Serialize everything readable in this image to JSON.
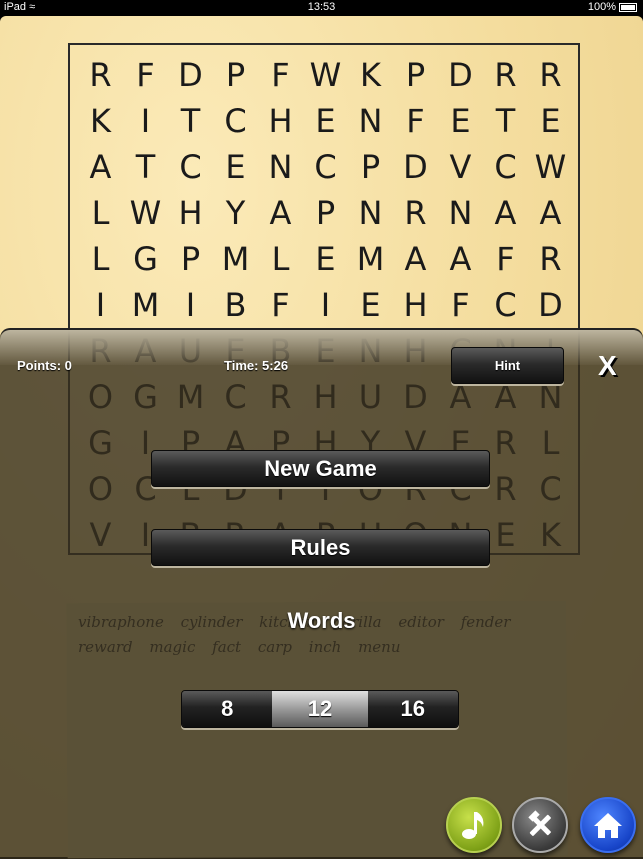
{
  "status_bar": {
    "device": "iPad",
    "time": "13:53",
    "battery": "100%"
  },
  "grid": {
    "rows": [
      [
        "R",
        "F",
        "D",
        "P",
        "F",
        "W",
        "K",
        "P",
        "D",
        "R",
        "R"
      ],
      [
        "K",
        "I",
        "T",
        "C",
        "H",
        "E",
        "N",
        "F",
        "E",
        "T",
        "E"
      ],
      [
        "A",
        "T",
        "C",
        "E",
        "N",
        "C",
        "P",
        "D",
        "V",
        "C",
        "W"
      ],
      [
        "L",
        "W",
        "H",
        "Y",
        "A",
        "P",
        "N",
        "R",
        "N",
        "A",
        "A"
      ],
      [
        "L",
        "G",
        "P",
        "M",
        "L",
        "E",
        "M",
        "A",
        "A",
        "F",
        "R"
      ],
      [
        "I",
        "M",
        "I",
        "B",
        "F",
        "I",
        "E",
        "H",
        "F",
        "C",
        "D"
      ],
      [
        "R",
        "A",
        "U",
        "E",
        "B",
        "E",
        "N",
        "H",
        "C",
        "N",
        "I"
      ],
      [
        "O",
        "G",
        "M",
        "C",
        "R",
        "H",
        "U",
        "D",
        "A",
        "A",
        "N"
      ],
      [
        "G",
        "I",
        "P",
        "A",
        "P",
        "H",
        "Y",
        "V",
        "E",
        "R",
        "L"
      ],
      [
        "O",
        "C",
        "L",
        "D",
        "T",
        "Y",
        "O",
        "R",
        "C",
        "R",
        "C"
      ],
      [
        "V",
        "I",
        "B",
        "R",
        "A",
        "P",
        "H",
        "O",
        "N",
        "E",
        "K"
      ]
    ]
  },
  "word_list": [
    "vibraphone",
    "cylinder",
    "kitchen",
    "gorilla",
    "editor",
    "fender",
    "reward",
    "magic",
    "fact",
    "carp",
    "inch",
    "menu"
  ],
  "hud": {
    "points": "Points: 0",
    "time": "Time: 5:26",
    "hint_label": "Hint",
    "close_label": "X"
  },
  "menu": {
    "new_game_label": "New Game",
    "rules_label": "Rules",
    "words_title": "Words",
    "word_count_options": [
      "8",
      "12",
      "16"
    ],
    "word_count_selected": "12"
  },
  "icons": {
    "music": "music-note-icon",
    "settings": "tools-icon",
    "home": "home-icon"
  }
}
